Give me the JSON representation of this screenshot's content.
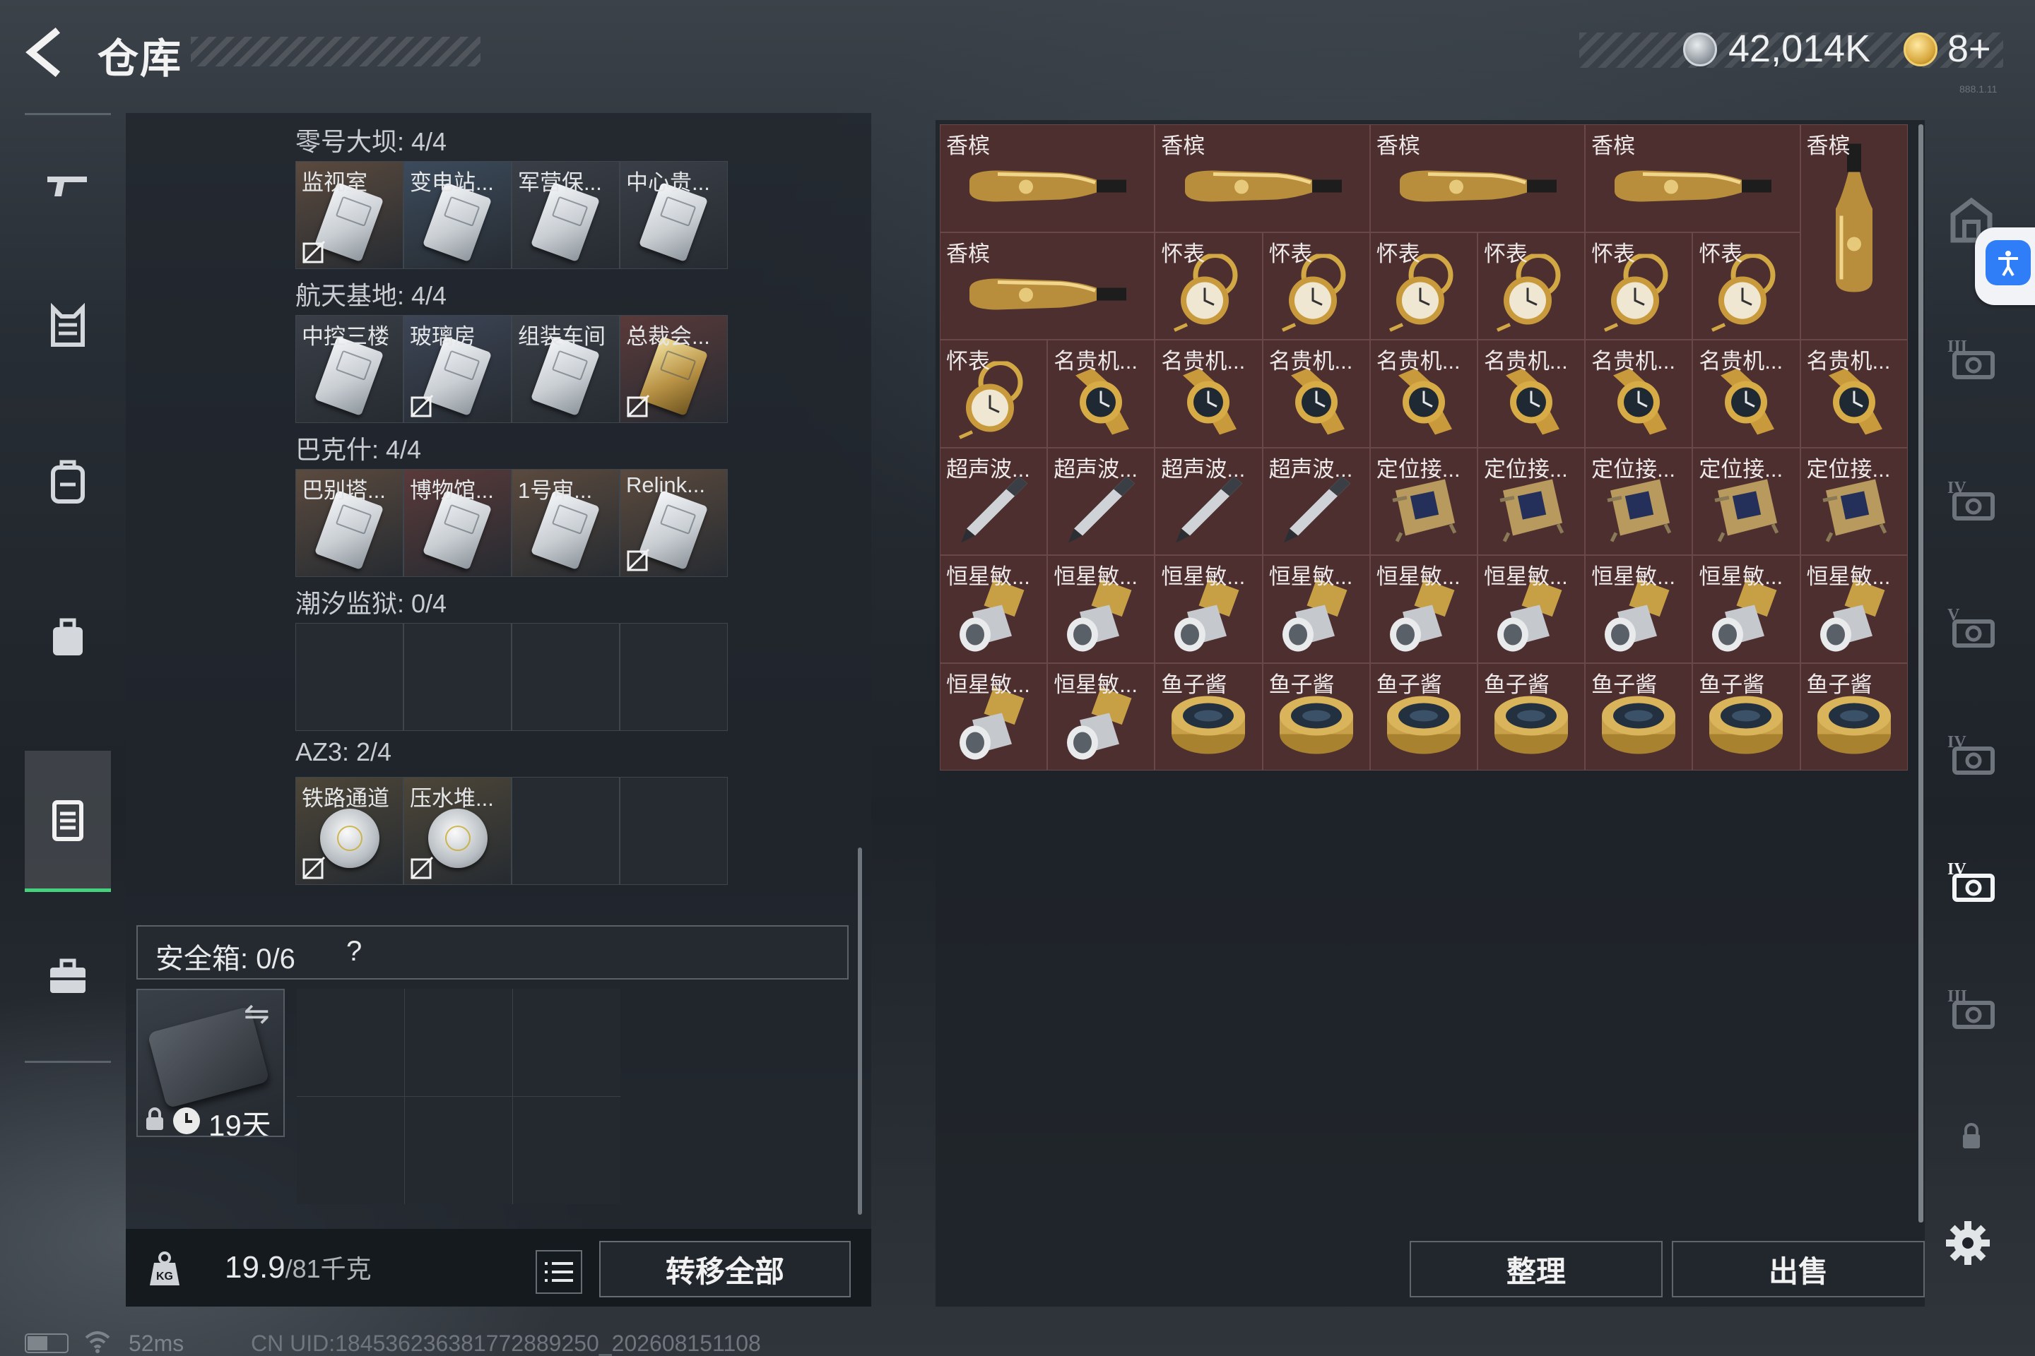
{
  "header": {
    "title": "仓库",
    "currency1": "42,014K",
    "currency2": "8+",
    "tiny_id": "888.1.11"
  },
  "left_nav": {
    "items": [
      "gun-icon",
      "armor-icon",
      "backpack-icon",
      "bag-icon",
      "keycard-holder-icon",
      "briefcase-icon"
    ],
    "active_index": 4
  },
  "key_groups": [
    {
      "title": "零号大坝: 4/4",
      "cards": [
        {
          "label": "监视室",
          "nodrop": true
        },
        {
          "label": "变电站...",
          "nodrop": false
        },
        {
          "label": "军营保...",
          "nodrop": false
        },
        {
          "label": "中心贵...",
          "nodrop": false
        }
      ]
    },
    {
      "title": "航天基地: 4/4",
      "cards": [
        {
          "label": "中控三楼",
          "nodrop": false
        },
        {
          "label": "玻璃房",
          "nodrop": true
        },
        {
          "label": "组装车间",
          "nodrop": false
        },
        {
          "label": "总裁会...",
          "nodrop": true
        }
      ]
    },
    {
      "title": "巴克什: 4/4",
      "cards": [
        {
          "label": "巴别塔...",
          "nodrop": false
        },
        {
          "label": "博物馆...",
          "nodrop": false
        },
        {
          "label": "1号审...",
          "nodrop": false
        },
        {
          "label": "Relink...",
          "nodrop": true
        }
      ]
    },
    {
      "title": "潮汐监狱: 0/4",
      "cards": []
    },
    {
      "title": "AZ3: 2/4",
      "cards": [
        {
          "label": "铁路通道",
          "nodrop": true
        },
        {
          "label": "压水堆...",
          "nodrop": true
        }
      ]
    }
  ],
  "safe_box": {
    "label": "安全箱:",
    "count": "0/6",
    "help": "?",
    "days": "19天"
  },
  "bottom_left": {
    "weight": "19.9",
    "weight_unit": "/81千克",
    "transfer_label": "转移全部"
  },
  "stash_items": [
    {
      "label": "香槟",
      "type": "champagne"
    },
    {
      "label": "香槟",
      "type": "champagne"
    },
    {
      "label": "香槟",
      "type": "champagne"
    },
    {
      "label": "香槟",
      "type": "champagne"
    },
    {
      "label": "香槟",
      "type": "champagne-tall"
    },
    {
      "label": "香槟",
      "type": "champagne"
    },
    {
      "label": "怀表",
      "type": "pocketwatch"
    },
    {
      "label": "怀表",
      "type": "pocketwatch"
    },
    {
      "label": "怀表",
      "type": "pocketwatch"
    },
    {
      "label": "怀表",
      "type": "pocketwatch"
    },
    {
      "label": "怀表",
      "type": "pocketwatch"
    },
    {
      "label": "怀表",
      "type": "pocketwatch"
    },
    {
      "label": "怀表",
      "type": "pocketwatch"
    },
    {
      "label": "名贵机...",
      "type": "wristwatch"
    },
    {
      "label": "名贵机...",
      "type": "wristwatch"
    },
    {
      "label": "名贵机...",
      "type": "wristwatch"
    },
    {
      "label": "名贵机...",
      "type": "wristwatch"
    },
    {
      "label": "名贵机...",
      "type": "wristwatch"
    },
    {
      "label": "名贵机...",
      "type": "wristwatch"
    },
    {
      "label": "名贵机...",
      "type": "wristwatch"
    },
    {
      "label": "名贵机...",
      "type": "wristwatch"
    },
    {
      "label": "超声波...",
      "type": "pen"
    },
    {
      "label": "超声波...",
      "type": "pen"
    },
    {
      "label": "超声波...",
      "type": "pen"
    },
    {
      "label": "超声波...",
      "type": "pen"
    },
    {
      "label": "定位接...",
      "type": "receiver"
    },
    {
      "label": "定位接...",
      "type": "receiver"
    },
    {
      "label": "定位接...",
      "type": "receiver"
    },
    {
      "label": "定位接...",
      "type": "receiver"
    },
    {
      "label": "定位接...",
      "type": "receiver"
    },
    {
      "label": "恒星敏...",
      "type": "sensor"
    },
    {
      "label": "恒星敏...",
      "type": "sensor"
    },
    {
      "label": "恒星敏...",
      "type": "sensor"
    },
    {
      "label": "恒星敏...",
      "type": "sensor"
    },
    {
      "label": "恒星敏...",
      "type": "sensor"
    },
    {
      "label": "恒星敏...",
      "type": "sensor"
    },
    {
      "label": "恒星敏...",
      "type": "sensor"
    },
    {
      "label": "恒星敏...",
      "type": "sensor"
    },
    {
      "label": "恒星敏...",
      "type": "sensor"
    },
    {
      "label": "恒星敏...",
      "type": "sensor"
    },
    {
      "label": "恒星敏...",
      "type": "sensor"
    },
    {
      "label": "鱼子酱",
      "type": "caviar"
    },
    {
      "label": "鱼子酱",
      "type": "caviar"
    },
    {
      "label": "鱼子酱",
      "type": "caviar"
    },
    {
      "label": "鱼子酱",
      "type": "caviar"
    },
    {
      "label": "鱼子酱",
      "type": "caviar"
    },
    {
      "label": "鱼子酱",
      "type": "caviar"
    },
    {
      "label": "鱼子酱",
      "type": "caviar"
    }
  ],
  "right_buttons": {
    "sort": "整理",
    "sell": "出售"
  },
  "right_nav": [
    {
      "name": "home-stash-icon",
      "text": ""
    },
    {
      "name": "tier-3-armor-icon",
      "text": "III"
    },
    {
      "name": "tier-4-helmet-icon",
      "text": "IV"
    },
    {
      "name": "tier-5-helmet-icon",
      "text": "V"
    },
    {
      "name": "tier-4-medkit-icon",
      "text": "IV"
    },
    {
      "name": "tier-4-ammo-icon",
      "text": "IV"
    },
    {
      "name": "tier-3-ammo-icon",
      "text": "III"
    },
    {
      "name": "lock-icon",
      "text": ""
    }
  ],
  "right_nav_active_index": 5,
  "status": {
    "ping": "52ms",
    "uid": "CN UID:1845362363817728892​50_202608151108"
  }
}
